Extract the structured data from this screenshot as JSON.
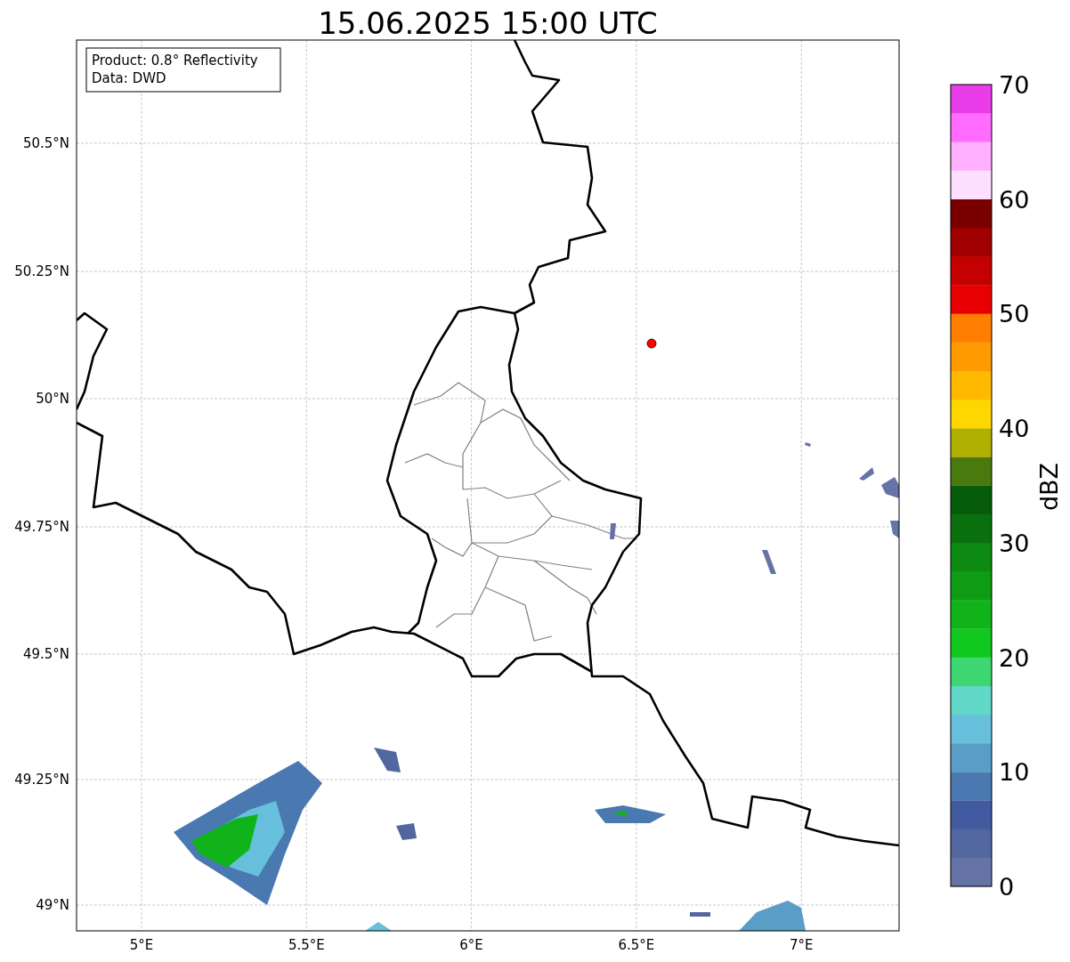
{
  "title": "15.06.2025 15:00 UTC",
  "info_box": [
    "Product: 0.8° Reflectivity",
    "Data: DWD"
  ],
  "map": {
    "lon_labels": [
      "5°E",
      "5.5°E",
      "6°E",
      "6.5°E",
      "7°E"
    ],
    "lat_labels": [
      "50.5°N",
      "50.25°N",
      "50°N",
      "49.75°N",
      "49.5°N",
      "49.25°N",
      "49°N"
    ],
    "marker": {
      "color": "#ff0000"
    }
  },
  "colorbar": {
    "label": "dBZ",
    "ticks": [
      "70",
      "60",
      "50",
      "40",
      "30",
      "20",
      "10",
      "0"
    ],
    "segments": [
      {
        "color": "#6673a6"
      },
      {
        "color": "#52679f"
      },
      {
        "color": "#425a9f"
      },
      {
        "color": "#4a78b0"
      },
      {
        "color": "#5a9ec8"
      },
      {
        "color": "#66c0dc"
      },
      {
        "color": "#62d8c8"
      },
      {
        "color": "#3dd670"
      },
      {
        "color": "#10c81e"
      },
      {
        "color": "#10b41a"
      },
      {
        "color": "#0e9c14"
      },
      {
        "color": "#0c8a12"
      },
      {
        "color": "#0a700e"
      },
      {
        "color": "#065c0a"
      },
      {
        "color": "#4a7a0e"
      },
      {
        "color": "#b0b000"
      },
      {
        "color": "#ffd700"
      },
      {
        "color": "#ffb900"
      },
      {
        "color": "#ff9b00"
      },
      {
        "color": "#ff7d00"
      },
      {
        "color": "#e60000"
      },
      {
        "color": "#c40000"
      },
      {
        "color": "#a00000"
      },
      {
        "color": "#7a0000"
      },
      {
        "color": "#ffdfff"
      },
      {
        "color": "#ffb0ff"
      },
      {
        "color": "#ff6cff"
      },
      {
        "color": "#e83de8"
      }
    ]
  }
}
